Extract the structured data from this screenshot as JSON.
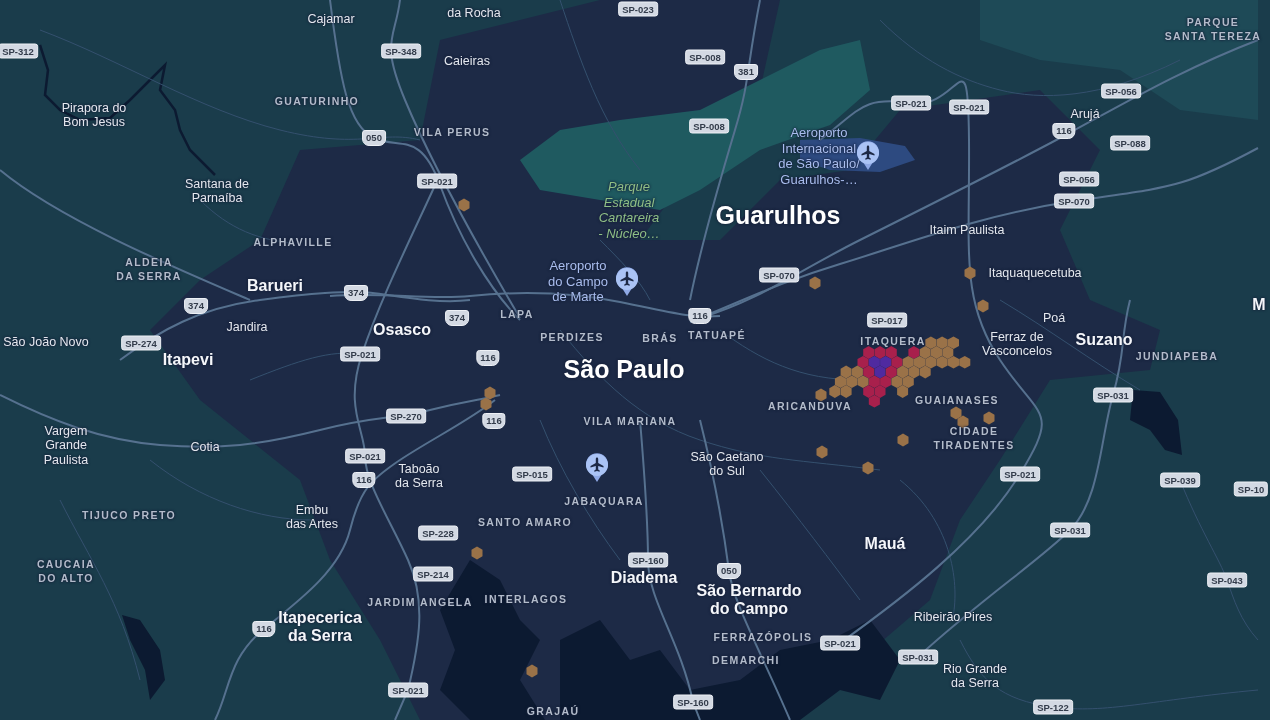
{
  "map": {
    "places": [
      {
        "name": "Cajamar",
        "kind": "town"
      },
      {
        "name": "da Rocha",
        "kind": "town"
      },
      {
        "name": "PARQUE\nSANTA TEREZA",
        "kind": "district"
      },
      {
        "name": "Caieiras",
        "kind": "town"
      },
      {
        "name": "Pirapora do\nBom Jesus",
        "kind": "town"
      },
      {
        "name": "GUATURINHO",
        "kind": "district"
      },
      {
        "name": "Arujá",
        "kind": "town"
      },
      {
        "name": "VILA PERUS",
        "kind": "district"
      },
      {
        "name": "Aeroporto\nInternacional\nde São Paulo/\nGuarulhos-…",
        "kind": "airport"
      },
      {
        "name": "Santana de\nParnaíba",
        "kind": "town"
      },
      {
        "name": "Parque\nEstadual\nCantareira\n- Núcleo…",
        "kind": "park"
      },
      {
        "name": "Guarulhos",
        "kind": "metro"
      },
      {
        "name": "Itaim Paulista",
        "kind": "town"
      },
      {
        "name": "ALPHAVILLE",
        "kind": "district"
      },
      {
        "name": "ALDEIA\nDA SERRA",
        "kind": "district"
      },
      {
        "name": "Barueri",
        "kind": "city"
      },
      {
        "name": "Aeroporto\ndo Campo\nde Marte",
        "kind": "airport"
      },
      {
        "name": "Itaquaquecetuba",
        "kind": "town"
      },
      {
        "name": "São João Novo",
        "kind": "town"
      },
      {
        "name": "Jandira",
        "kind": "town"
      },
      {
        "name": "Osasco",
        "kind": "city"
      },
      {
        "name": "LAPA",
        "kind": "district"
      },
      {
        "name": "Poá",
        "kind": "town"
      },
      {
        "name": "M",
        "kind": "city"
      },
      {
        "name": "Itapevi",
        "kind": "city"
      },
      {
        "name": "PERDIZES",
        "kind": "district"
      },
      {
        "name": "BRÁS",
        "kind": "district"
      },
      {
        "name": "TATUAPÉ",
        "kind": "district"
      },
      {
        "name": "São Paulo",
        "kind": "metro"
      },
      {
        "name": "ITAQUERA",
        "kind": "district"
      },
      {
        "name": "Ferraz de\nVasconcelos",
        "kind": "town"
      },
      {
        "name": "Suzano",
        "kind": "city"
      },
      {
        "name": "JUNDIAPEBA",
        "kind": "district"
      },
      {
        "name": "ARICANDUVA",
        "kind": "district"
      },
      {
        "name": "GUAIANASES",
        "kind": "district"
      },
      {
        "name": "Vargem\nGrande\nPaulista",
        "kind": "town"
      },
      {
        "name": "Cotia",
        "kind": "town"
      },
      {
        "name": "VILA MARIANA",
        "kind": "district"
      },
      {
        "name": "CIDADE\nTIRADENTES",
        "kind": "district"
      },
      {
        "name": "Taboão\nda Serra",
        "kind": "town"
      },
      {
        "name": "São Caetano\ndo Sul",
        "kind": "town"
      },
      {
        "name": "TIJUCO PRETO",
        "kind": "district"
      },
      {
        "name": "Embu\ndas Artes",
        "kind": "town"
      },
      {
        "name": "JABAQUARA",
        "kind": "district"
      },
      {
        "name": "SANTO AMARO",
        "kind": "district"
      },
      {
        "name": "Mauá",
        "kind": "city"
      },
      {
        "name": "CAUCAIA\nDO ALTO",
        "kind": "district"
      },
      {
        "name": "Diadema",
        "kind": "city"
      },
      {
        "name": "Itapecerica\nda Serra",
        "kind": "city"
      },
      {
        "name": "JARDIM ANGELA",
        "kind": "district"
      },
      {
        "name": "INTERLAGOS",
        "kind": "district"
      },
      {
        "name": "São Bernardo\ndo Campo",
        "kind": "city"
      },
      {
        "name": "Ribeirão Pires",
        "kind": "town"
      },
      {
        "name": "FERRAZÓPOLIS",
        "kind": "district"
      },
      {
        "name": "DEMARCHI",
        "kind": "district"
      },
      {
        "name": "Rio Grande\nda Serra",
        "kind": "town"
      },
      {
        "name": "GRAJAÚ",
        "kind": "district"
      }
    ],
    "road_shields": [
      {
        "label": "SP-312",
        "kind": "state"
      },
      {
        "label": "SP-348",
        "kind": "state"
      },
      {
        "label": "SP-023",
        "kind": "state"
      },
      {
        "label": "SP-008",
        "kind": "state"
      },
      {
        "label": "381",
        "kind": "federal"
      },
      {
        "label": "SP-008",
        "kind": "state"
      },
      {
        "label": "SP-021",
        "kind": "state"
      },
      {
        "label": "SP-021",
        "kind": "state"
      },
      {
        "label": "SP-056",
        "kind": "state"
      },
      {
        "label": "116",
        "kind": "federal"
      },
      {
        "label": "SP-088",
        "kind": "state"
      },
      {
        "label": "SP-056",
        "kind": "state"
      },
      {
        "label": "SP-070",
        "kind": "state"
      },
      {
        "label": "050",
        "kind": "federal"
      },
      {
        "label": "SP-021",
        "kind": "state"
      },
      {
        "label": "SP-070",
        "kind": "state"
      },
      {
        "label": "116",
        "kind": "federal"
      },
      {
        "label": "SP-017",
        "kind": "state"
      },
      {
        "label": "374",
        "kind": "federal"
      },
      {
        "label": "374",
        "kind": "federal"
      },
      {
        "label": "374",
        "kind": "federal"
      },
      {
        "label": "SP-274",
        "kind": "state"
      },
      {
        "label": "SP-021",
        "kind": "state"
      },
      {
        "label": "116",
        "kind": "federal"
      },
      {
        "label": "SP-031",
        "kind": "state"
      },
      {
        "label": "SP-270",
        "kind": "state"
      },
      {
        "label": "116",
        "kind": "federal"
      },
      {
        "label": "SP-021",
        "kind": "state"
      },
      {
        "label": "116",
        "kind": "federal"
      },
      {
        "label": "SP-015",
        "kind": "state"
      },
      {
        "label": "SP-021",
        "kind": "state"
      },
      {
        "label": "SP-039",
        "kind": "state"
      },
      {
        "label": "SP-10",
        "kind": "state"
      },
      {
        "label": "SP-031",
        "kind": "state"
      },
      {
        "label": "SP-228",
        "kind": "state"
      },
      {
        "label": "SP-160",
        "kind": "state"
      },
      {
        "label": "050",
        "kind": "federal"
      },
      {
        "label": "SP-214",
        "kind": "state"
      },
      {
        "label": "SP-043",
        "kind": "state"
      },
      {
        "label": "116",
        "kind": "federal"
      },
      {
        "label": "SP-021",
        "kind": "state"
      },
      {
        "label": "SP-031",
        "kind": "state"
      },
      {
        "label": "SP-021",
        "kind": "state"
      },
      {
        "label": "SP-160",
        "kind": "state"
      },
      {
        "label": "SP-122",
        "kind": "state"
      }
    ]
  }
}
